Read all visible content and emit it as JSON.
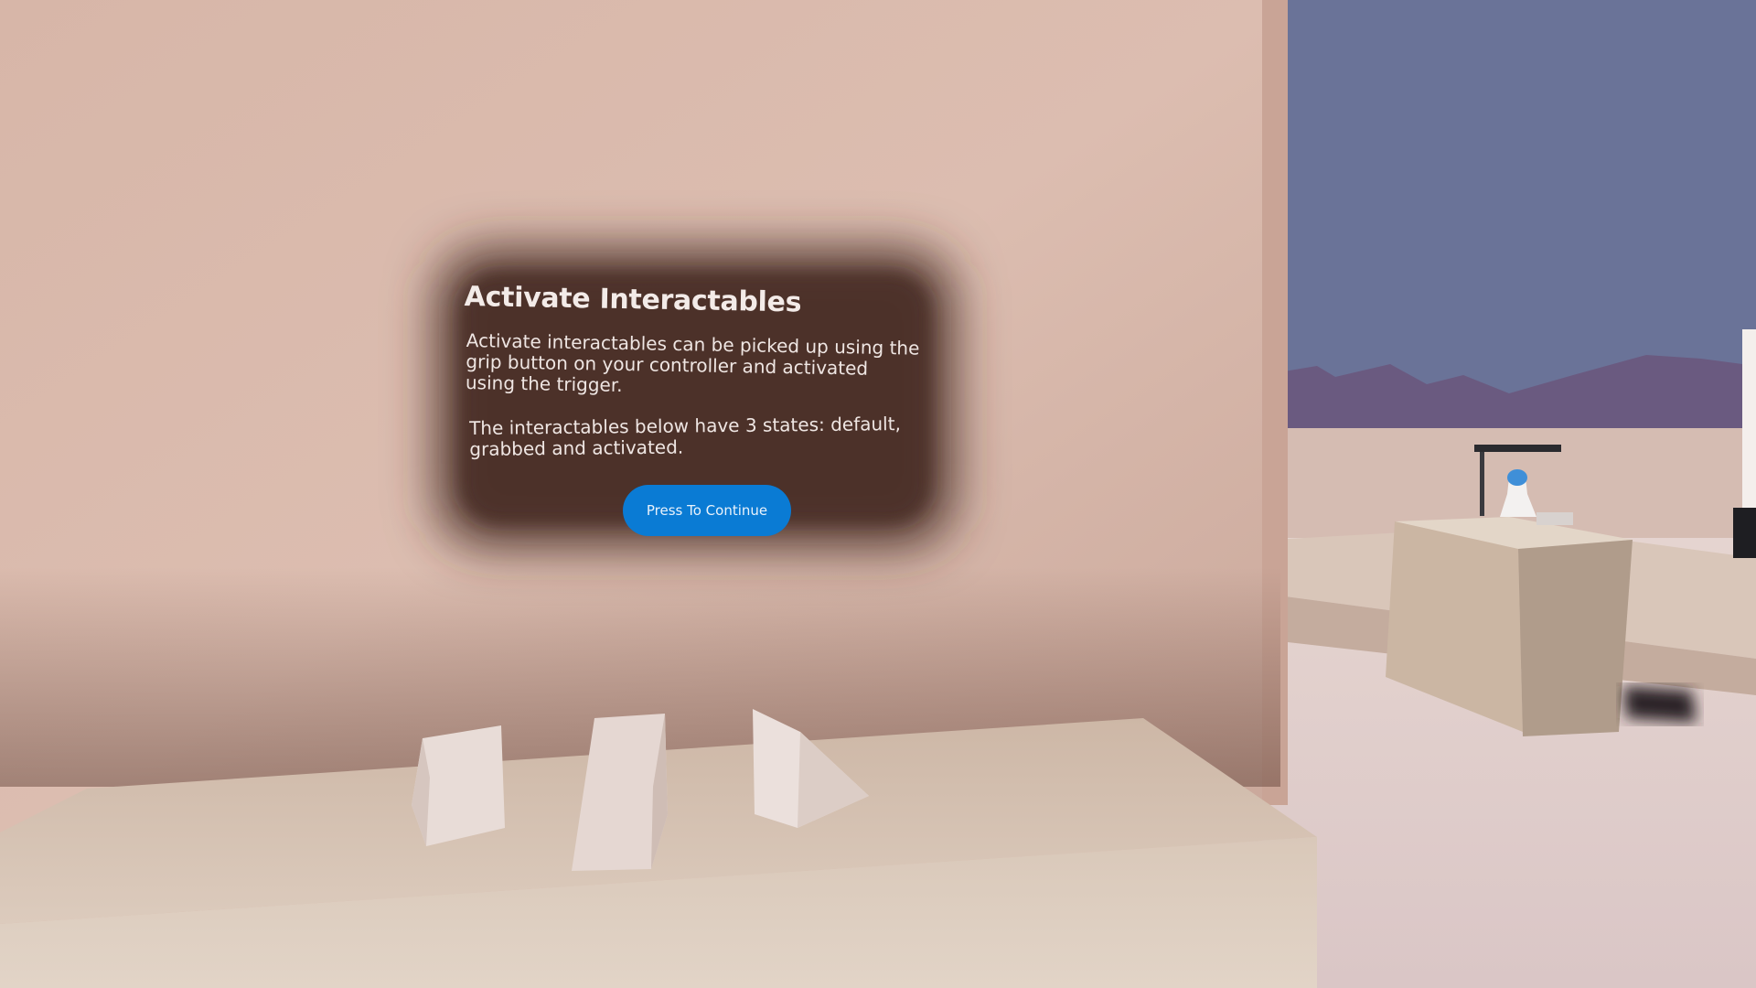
{
  "dialog": {
    "title": "Activate Interactables",
    "body": "Activate interactables can be picked up using the grip button on your controller and activated using the trigger.",
    "note": "The interactables below have 3 states: default, grabbed and activated.",
    "continue_label": "Press To Continue"
  },
  "colors": {
    "wall": "#d9b9ab",
    "sky": "#6a7398",
    "mountains": "#6a5a80",
    "panel": "#4a2f28",
    "button": "#0a7bd4",
    "table": "#d8c3b2"
  },
  "scene": {
    "interactables": [
      "default-state-object",
      "grabbed-state-object",
      "activated-state-object"
    ]
  }
}
